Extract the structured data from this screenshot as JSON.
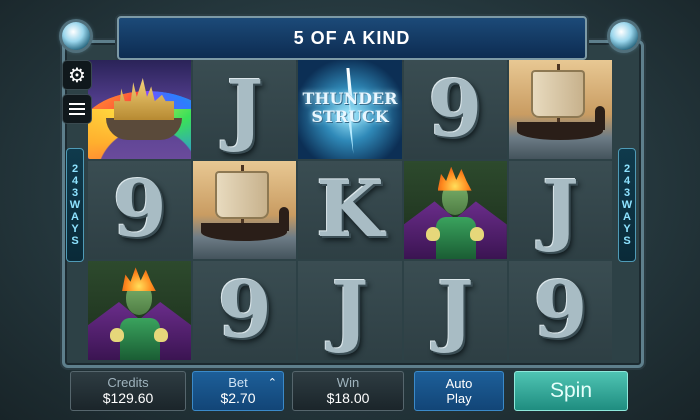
{
  "title": {
    "banner": "5 OF A KIND"
  },
  "ways": {
    "left": [
      "2",
      "4",
      "3",
      "W",
      "A",
      "Y",
      "S"
    ],
    "right": [
      "2",
      "4",
      "3",
      "W",
      "A",
      "Y",
      "S"
    ]
  },
  "side_controls": {
    "settings_icon": "gear-icon",
    "paytable_icon": "menu-list-icon"
  },
  "reels": [
    [
      "castle",
      "9",
      "loki"
    ],
    [
      "J",
      "ship",
      "9"
    ],
    [
      "thunderstruck",
      "K",
      "J"
    ],
    [
      "9",
      "loki",
      "J"
    ],
    [
      "ship",
      "J",
      "9"
    ]
  ],
  "thunderstruck_logo": [
    "THUNDER",
    "STRUCK"
  ],
  "bottom": {
    "credits_label": "Credits",
    "credits_value": "$129.60",
    "bet_label": "Bet",
    "bet_value": "$2.70",
    "win_label": "Win",
    "win_value": "$18.00",
    "auto_label_1": "Auto",
    "auto_label_2": "Play",
    "spin_label": "Spin"
  },
  "colors": {
    "accent": "#1d5f99",
    "spin": "#35a99a",
    "ways_text": "#8ee3ff"
  }
}
